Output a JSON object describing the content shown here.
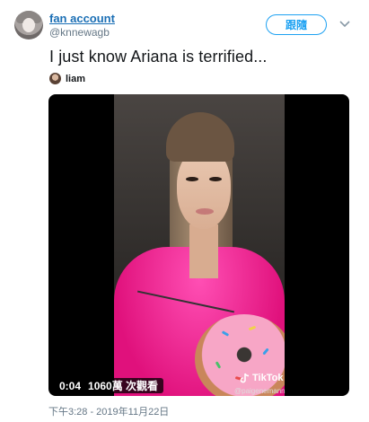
{
  "author": {
    "display_name": "fan account",
    "handle": "@knnewagb",
    "avatar_icon": "avatar"
  },
  "follow_button": {
    "label": "跟隨",
    "color": "#1da1f2"
  },
  "tweet": {
    "text": "I just know Ariana is terrified...",
    "tagged_user": "liam",
    "timestamp": "下午3:28 - 2019年11月22日"
  },
  "video": {
    "time": "0:04",
    "views": "1060萬 次觀看",
    "watermark_brand": "TikTok",
    "watermark_user": "@paigenemann"
  }
}
